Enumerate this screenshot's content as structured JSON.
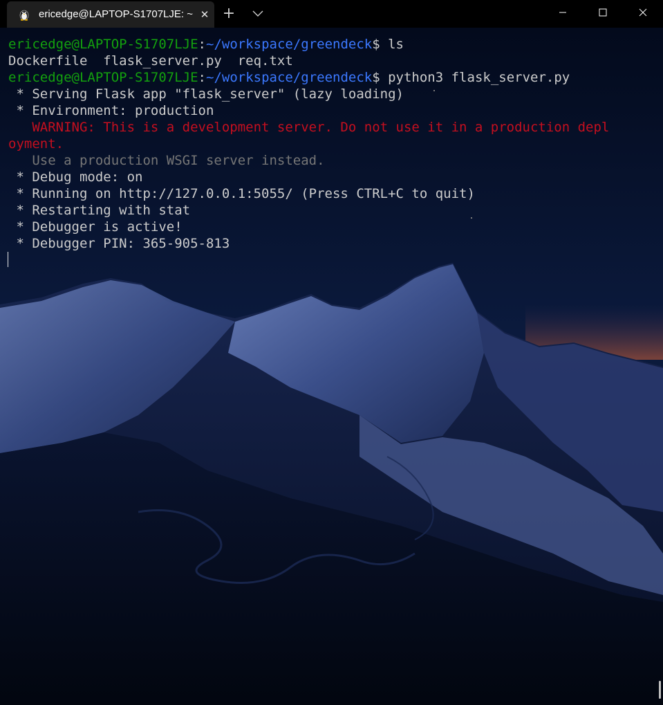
{
  "window": {
    "tab_title": "ericedge@LAPTOP-S1707LJE: ~",
    "tab_icon": "linux-penguin-icon",
    "new_tab": "+",
    "close_tab": "✕"
  },
  "terminal": {
    "prompt_user": "ericedge@LAPTOP-S1707LJE",
    "prompt_sep": ":",
    "prompt_path": "~/workspace/greendeck",
    "prompt_end": "$ ",
    "cmd1": "ls",
    "ls_output": "Dockerfile  flask_server.py  req.txt",
    "cmd2": "python3 flask_server.py",
    "out1": " * Serving Flask app \"flask_server\" (lazy loading)",
    "out2": " * Environment: production",
    "warn1": "   WARNING: This is a development server. Do not use it in a production depl",
    "warn2": "oyment.",
    "out3": "   Use a production WSGI server instead.",
    "out4": " * Debug mode: on",
    "out5": " * Running on http://127.0.0.1:5055/ (Press CTRL+C to quit)",
    "out6": " * Restarting with stat",
    "out7": " * Debugger is active!",
    "out8": " * Debugger PIN: 365-905-813"
  },
  "colors": {
    "prompt_user": "#13a10e",
    "prompt_path": "#3b78ff",
    "warning": "#c50f1f",
    "dim": "#767676",
    "text": "#cccccc",
    "tab_background": "#1f1f1f"
  }
}
